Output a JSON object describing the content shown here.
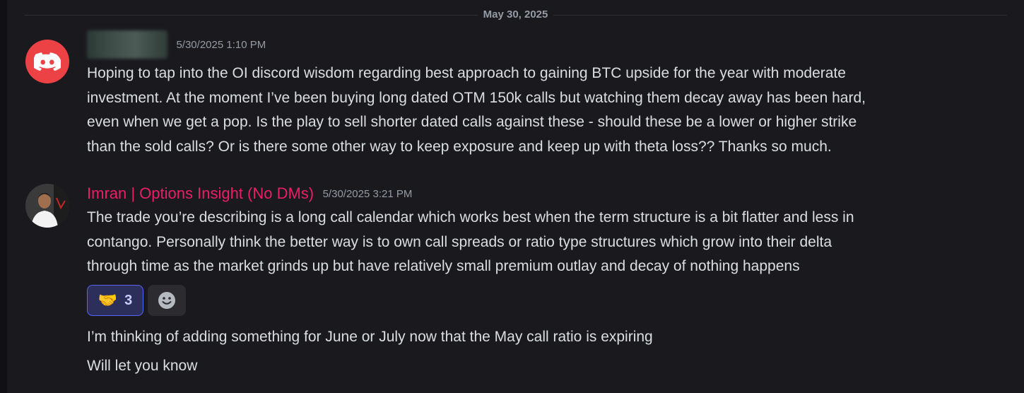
{
  "date_divider": "May 30, 2025",
  "messages": [
    {
      "avatar": "discord-logo-icon",
      "username": "",
      "timestamp": "5/30/2025 1:10 PM",
      "lines": [
        "Hoping to tap into the OI discord wisdom regarding best approach to gaining BTC upside for the year with moderate",
        "investment. At the moment I’ve been buying long dated OTM 150k calls but watching them decay away has been hard,",
        "even when we get a pop. Is the play to sell shorter dated calls against these - should these be a lower or higher strike",
        "than the sold calls? Or is there some other way to keep exposure and keep up with theta loss?? Thanks so much."
      ]
    },
    {
      "avatar": "user-photo",
      "username": "Imran | Options Insight (No DMs)",
      "username_color": "#e91e63",
      "timestamp": "5/30/2025 3:21 PM",
      "lines": [
        "The trade you’re describing is a long call calendar which works best when the term structure is a bit flatter and less in",
        "contango. Personally think the better way is to own call spreads or ratio type structures which grow into their delta",
        "through time as the market grinds up but have relatively small premium outlay and decay of nothing happens"
      ],
      "reactions": [
        {
          "emoji": "🤝",
          "count": "3",
          "active": true
        }
      ],
      "add_reaction_icon": "smiley-icon",
      "followups": [
        "I’m thinking of adding something for June or July now that the May call ratio is expiring",
        "Will let you know"
      ]
    }
  ]
}
